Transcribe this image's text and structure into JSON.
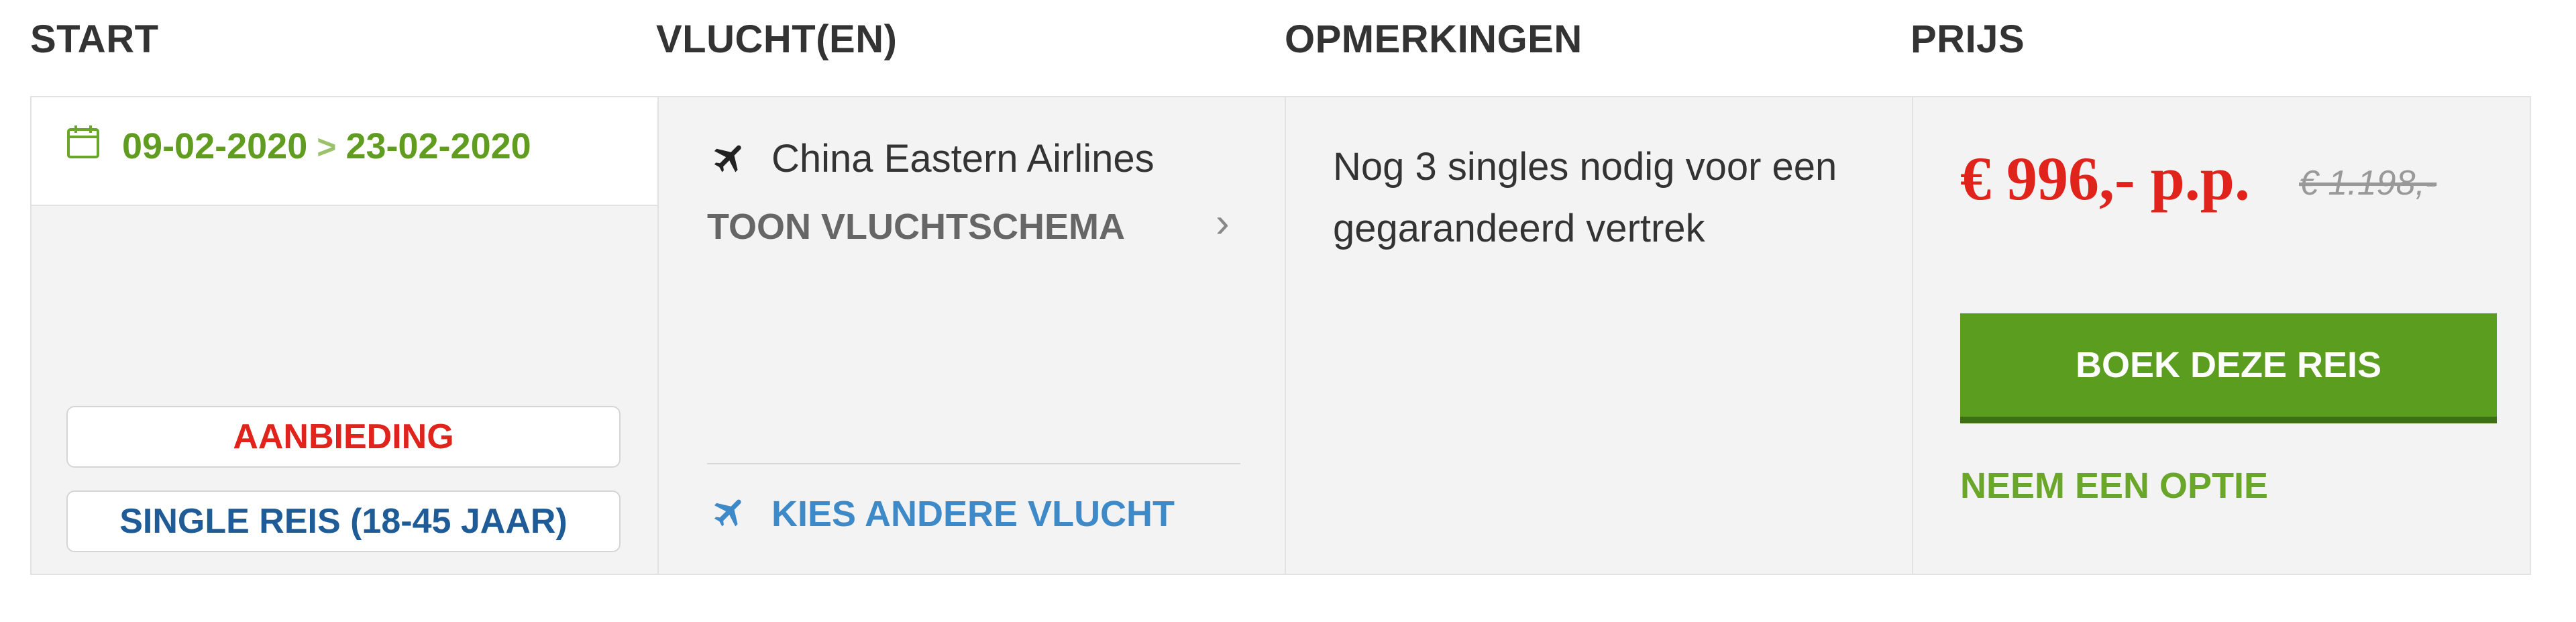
{
  "headers": {
    "start": "START",
    "flights": "VLUCHT(EN)",
    "remarks": "OPMERKINGEN",
    "price": "PRIJS"
  },
  "start": {
    "date_from": "09-02-2020",
    "separator": ">",
    "date_to": "23-02-2020",
    "tags": {
      "offer": "AANBIEDING",
      "single": "SINGLE REIS (18-45 JAAR)"
    }
  },
  "flight": {
    "airline": "China Eastern Airlines",
    "schedule_link": "TOON VLUCHTSCHEMA",
    "schedule_chevron": "›",
    "choose_other": "KIES ANDERE VLUCHT"
  },
  "remarks": {
    "text": "Nog 3 singles nodig voor een gegarandeerd vertrek"
  },
  "price": {
    "current": "€ 996,- p.p.",
    "old": "€ 1.198,-",
    "book_button": "BOEK DEZE REIS",
    "option_link": "NEEM EEN OPTIE"
  },
  "icons": {
    "calendar": "calendar-icon",
    "plane": "plane-icon"
  },
  "colors": {
    "green": "#5f9c1f",
    "red": "#e0231b",
    "blue_link": "#3e8ac8",
    "navy": "#1f5b96"
  }
}
